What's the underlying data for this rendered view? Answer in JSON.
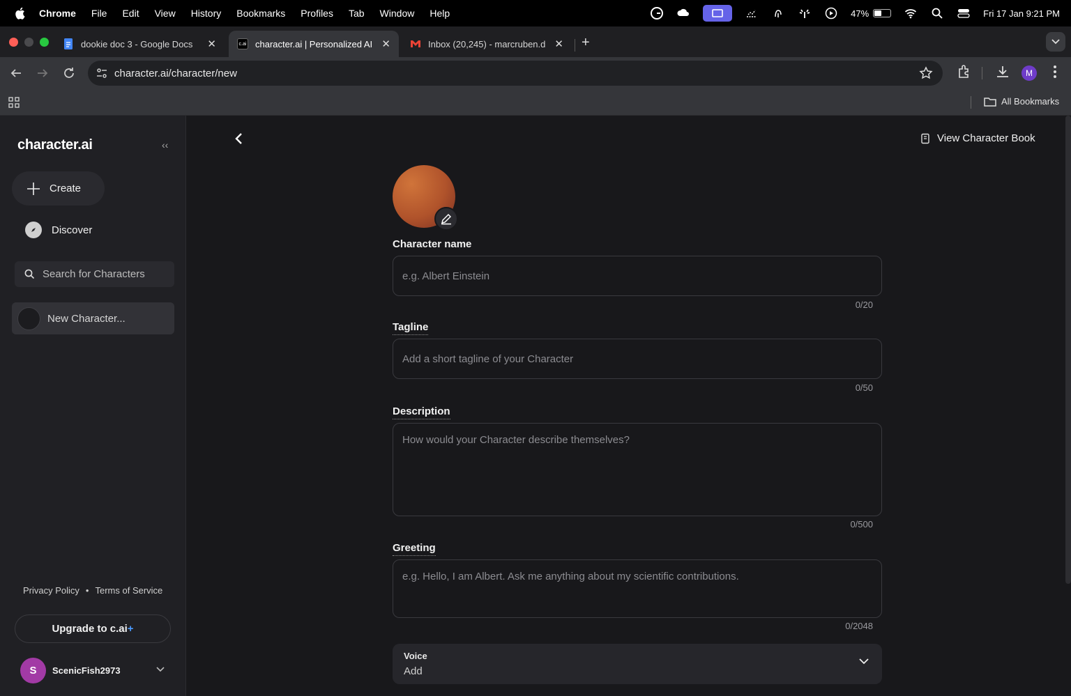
{
  "menubar": {
    "items": [
      "Chrome",
      "File",
      "Edit",
      "View",
      "History",
      "Bookmarks",
      "Profiles",
      "Tab",
      "Window",
      "Help"
    ],
    "battery": "47%",
    "datetime": "Fri 17 Jan  9:21 PM"
  },
  "tabs": [
    {
      "title": "dookie doc 3 - Google Docs",
      "favicon": "google-docs-icon",
      "color": "#4285f4"
    },
    {
      "title": "character.ai | Personalized AI",
      "favicon": "characterai-icon",
      "color": "#ffffff"
    },
    {
      "title": "Inbox (20,245) - marcruben.d",
      "favicon": "gmail-icon",
      "color": "#ea4335"
    }
  ],
  "address": {
    "url": "character.ai/character/new"
  },
  "profile_initial": "M",
  "bookmarks": {
    "all_label": "All Bookmarks"
  },
  "sidebar": {
    "logo": "character.ai",
    "create_label": "Create",
    "discover_label": "Discover",
    "search_placeholder": "Search for Characters",
    "recent_item": "New Character...",
    "privacy": "Privacy Policy",
    "dot": "•",
    "terms": "Terms of Service",
    "upgrade_label": "Upgrade to c.ai",
    "upgrade_plus": "+",
    "user_initial": "S",
    "username": "ScenicFish2973"
  },
  "main": {
    "view_book": "View Character Book",
    "name": {
      "label": "Character name",
      "placeholder": "e.g. Albert Einstein",
      "counter": "0/20"
    },
    "tagline": {
      "label": "Tagline",
      "placeholder": "Add a short tagline of your Character",
      "counter": "0/50"
    },
    "description": {
      "label": "Description",
      "placeholder": "How would your Character describe themselves?",
      "counter": "0/500"
    },
    "greeting": {
      "label": "Greeting",
      "placeholder": "e.g. Hello, I am Albert. Ask me anything about my scientific contributions.",
      "counter": "0/2048"
    },
    "voice": {
      "label": "Voice",
      "value": "Add"
    }
  },
  "colors": {
    "accent": "#4b9bff",
    "avatar": "#c0602f",
    "user_avatar": "#a23aa5"
  }
}
